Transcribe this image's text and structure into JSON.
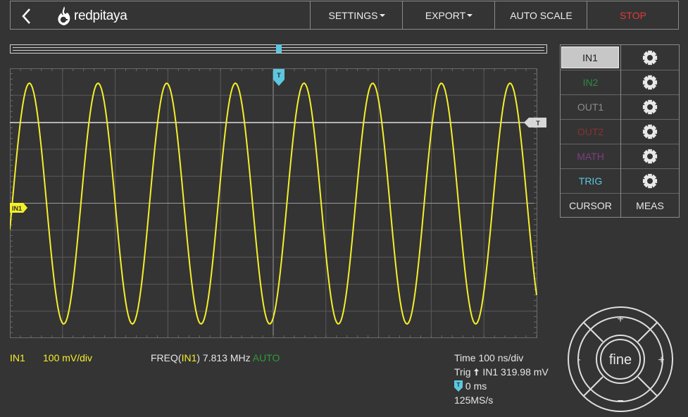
{
  "app": {
    "brand": "redpitaya"
  },
  "menu": {
    "settings": "SETTINGS",
    "export": "EXPORT",
    "autoscale": "AUTO SCALE",
    "stop": "STOP"
  },
  "colors": {
    "in1": "#f5ef2a",
    "in2": "#2e8b3e",
    "out1": "#8c8c8c",
    "out2": "#8a3131",
    "math": "#7c3f84",
    "trig": "#5bc8e0",
    "auto": "#2e9c3a",
    "stop": "#e23a3a"
  },
  "channels": [
    {
      "label": "IN1"
    },
    {
      "label": "IN2"
    },
    {
      "label": "OUT1"
    },
    {
      "label": "OUT2"
    },
    {
      "label": "MATH"
    },
    {
      "label": "TRIG"
    }
  ],
  "tools": {
    "cursor": "CURSOR",
    "meas": "MEAS"
  },
  "markers": {
    "trigger_time": "T",
    "trigger_level": "T",
    "channel": "IN1"
  },
  "status": {
    "channel": "IN1",
    "scale": "100 mV/div",
    "freq_prefix": "FREQ(",
    "freq_channel": "IN1",
    "freq_value": ") 7.813 MHz",
    "mode": "AUTO",
    "time": "Time 100 ns/div",
    "trig_prefix": "Trig",
    "trig_value": "IN1 319.98 mV",
    "offset_value": "0 ms",
    "sample_rate": "125MS/s"
  },
  "jog": {
    "center": "fine",
    "up": "+",
    "down": "−",
    "left": "-",
    "right": "+"
  }
}
